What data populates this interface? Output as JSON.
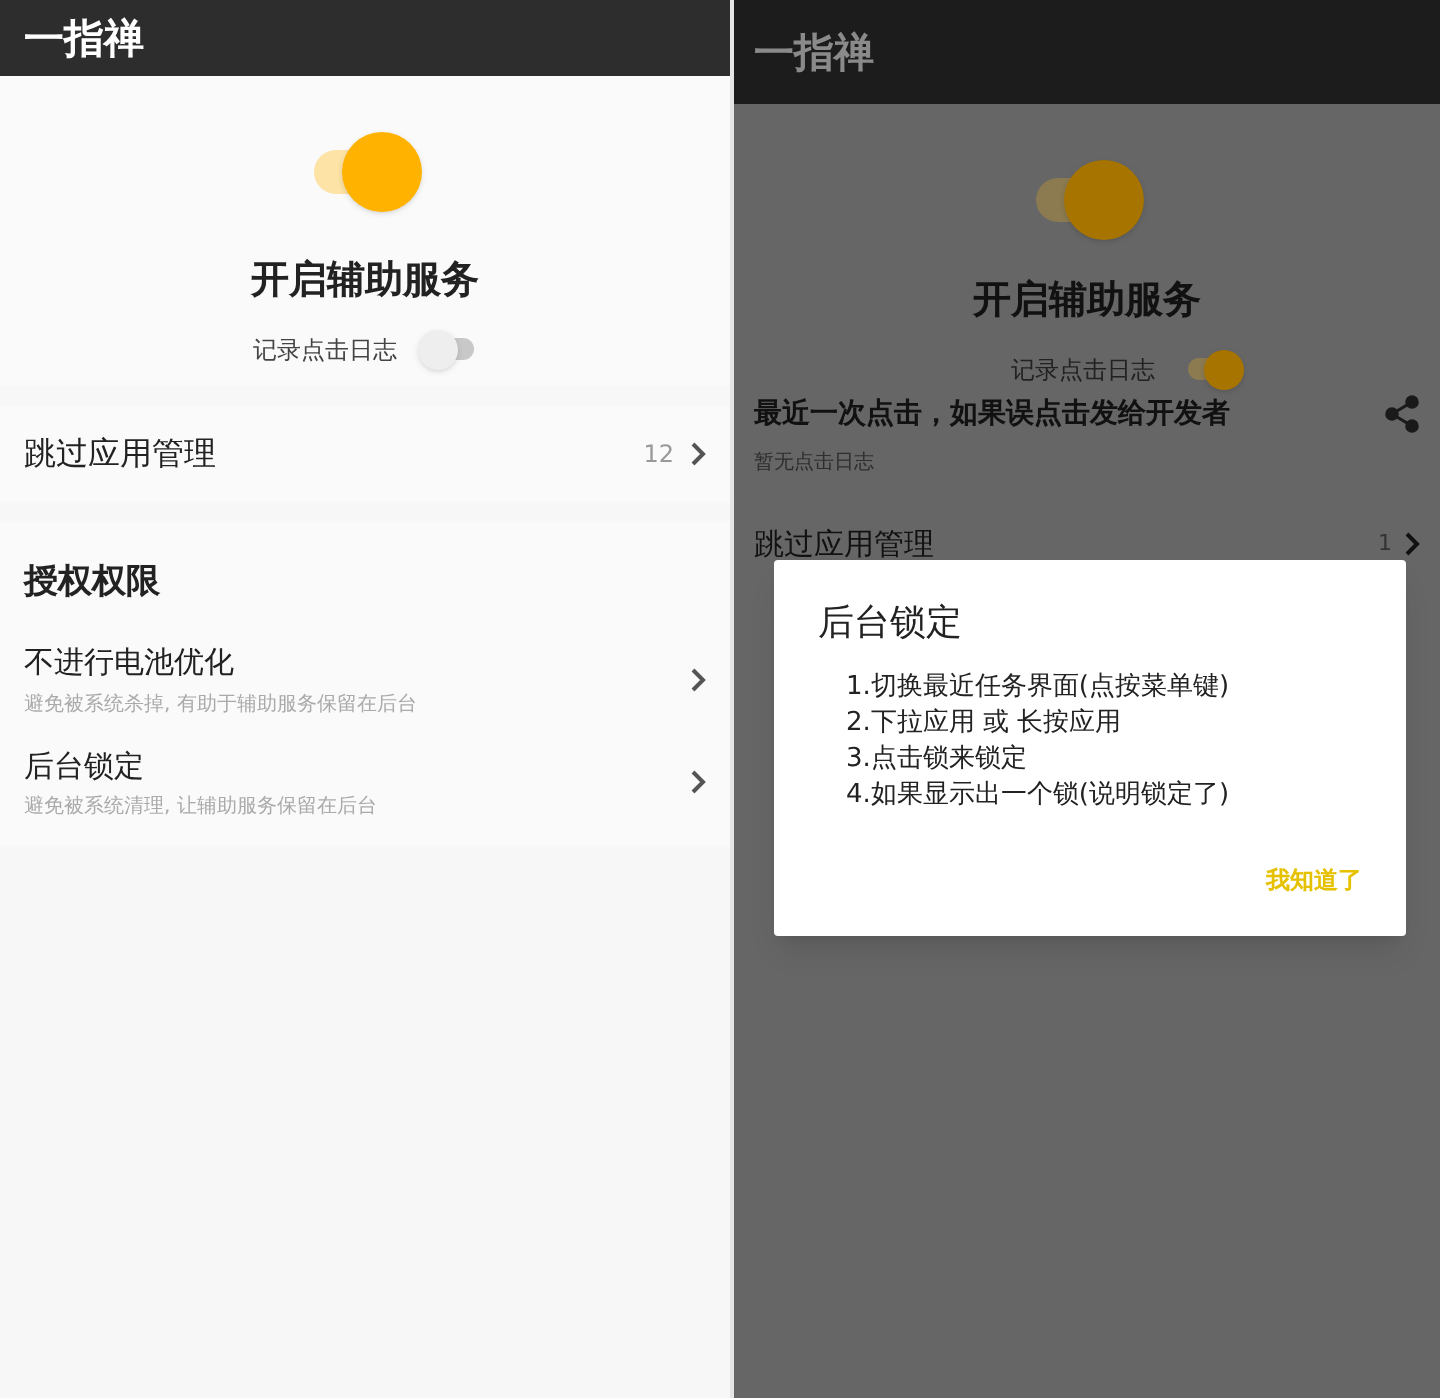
{
  "left_screen": {
    "app_title": "一指禅",
    "service_switch": {
      "on": true,
      "label": "开启辅助服务"
    },
    "log_toggle": {
      "label": "记录点击日志",
      "on": false
    },
    "skip_row": {
      "label": "跳过应用管理",
      "count": "12"
    },
    "section": {
      "header": "授权权限",
      "items": [
        {
          "title": "不进行电池优化",
          "subtitle": "避免被系统杀掉, 有助于辅助服务保留在后台"
        },
        {
          "title": "后台锁定",
          "subtitle": "避免被系统清理, 让辅助服务保留在后台"
        }
      ]
    }
  },
  "right_screen": {
    "app_title": "一指禅",
    "service_switch": {
      "on": true,
      "label": "开启辅助服务"
    },
    "log_toggle": {
      "label": "记录点击日志",
      "on": true
    },
    "recent_click": {
      "title": "最近一次点击，如果误点击发给开发者",
      "empty_text": "暂无点击日志"
    },
    "skip_row": {
      "label": "跳过应用管理",
      "count": "1"
    },
    "dialog": {
      "title": "后台锁定",
      "steps": [
        "1.切换最近任务界面(点按菜单键)",
        "2.下拉应用 或 长按应用",
        "3.点击锁来锁定",
        "4.如果显示出一个锁(说明锁定了)"
      ],
      "button": "我知道了"
    }
  }
}
